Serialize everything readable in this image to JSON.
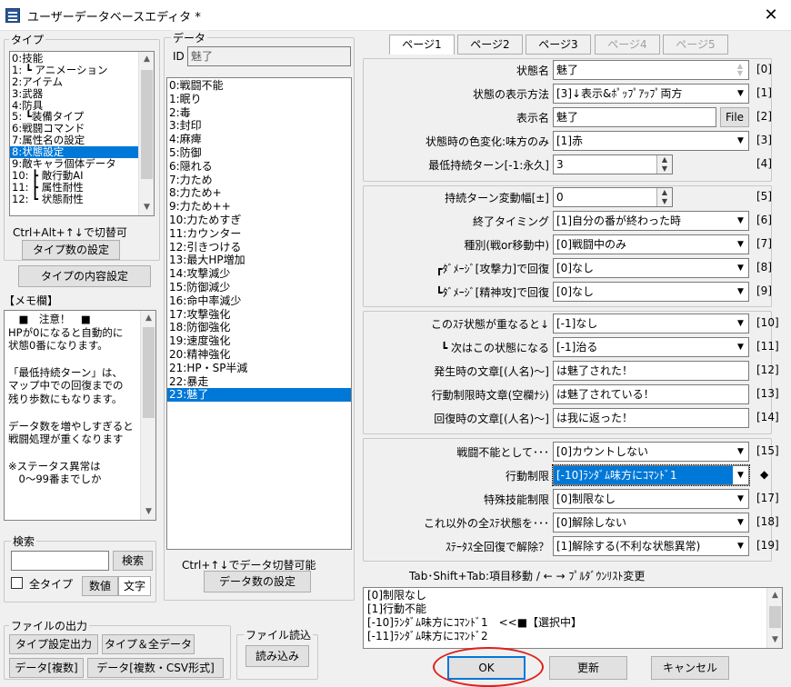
{
  "window": {
    "title": "ユーザーデータベースエディタ *",
    "close": "✕"
  },
  "type_panel": {
    "label": "タイプ",
    "items": [
      "0:技能",
      "1: ┗ アニメーション",
      "2:アイテム",
      "3:武器",
      "4:防具",
      "5: ┗装備タイプ",
      "6:戦闘コマンド",
      "7:属性名の設定",
      "8:状態設定",
      "9:敵キャラ個体データ",
      "10: ┣ 敵行動AI",
      "11: ┣ 属性耐性",
      "12: ┗ 状態耐性"
    ],
    "selected": 8,
    "hint": "Ctrl+Alt+↑↓で切替可",
    "count_button": "タイプ数の設定",
    "content_button": "タイプの内容設定"
  },
  "memo": {
    "label": "【メモ欄】",
    "lines": [
      "　■　注意！　■",
      "HPが0になると自動的に",
      "状態0番になります。",
      "",
      "「最低持続ターン」は、",
      "マップ中での回復までの",
      "残り歩数にもなります。",
      "",
      "データ数を増やしすぎると",
      "戦闘処理が重くなります",
      "",
      "※ステータス異常は",
      "　0〜99番までしか"
    ]
  },
  "search": {
    "label": "検索",
    "button": "検索",
    "all_types": "全タイプ",
    "value_btn": "数値",
    "text_btn": "文字"
  },
  "file_output": {
    "label": "ファイルの出力",
    "btn1": "タイプ設定出力",
    "btn2": "タイプ＆全データ",
    "btn3": "データ[複数]",
    "btn4": "データ[複数・CSV形式]"
  },
  "file_input": {
    "label": "ファイル読込",
    "btn": "読み込み"
  },
  "data_panel": {
    "label": "データ",
    "id_label": "ID",
    "id_value": "魅了",
    "items": [
      "0:戦闘不能",
      "1:眠り",
      "2:毒",
      "3:封印",
      "4:麻痺",
      "5:防御",
      "6:隠れる",
      "7:力ため",
      "8:力ため+",
      "9:力ため++",
      "10:力ためすぎ",
      "11:カウンター",
      "12:引きつける",
      "13:最大HP増加",
      "14:攻撃減少",
      "15:防御減少",
      "16:命中率減少",
      "17:攻撃強化",
      "18:防御強化",
      "19:速度強化",
      "20:精神強化",
      "21:HP・SP半減",
      "22:暴走",
      "23:魅了"
    ],
    "selected": 23,
    "hint": "Ctrl+↑↓でデータ切替可能",
    "count_button": "データ数の設定"
  },
  "tabs": [
    {
      "label": "ページ1",
      "state": "active"
    },
    {
      "label": "ページ2",
      "state": "normal"
    },
    {
      "label": "ページ3",
      "state": "normal"
    },
    {
      "label": "ページ4",
      "state": "disabled"
    },
    {
      "label": "ページ5",
      "state": "disabled"
    }
  ],
  "section1": [
    {
      "label": "状態名",
      "kind": "text",
      "value": "魅了",
      "index": "[0]"
    },
    {
      "label": "状態の表示方法",
      "kind": "dropdown",
      "value": "[3]↓表示&ﾎﾟｯﾌﾟｱｯﾌﾟ両方",
      "index": "[1]"
    },
    {
      "label": "表示名",
      "kind": "file",
      "value": "魅了",
      "button": "File",
      "index": "[2]"
    },
    {
      "label": "状態時の色変化:味方のみ",
      "kind": "dropdown",
      "value": "[1]赤",
      "index": "[3]"
    },
    {
      "label": "最低持続ターン[-1:永久]",
      "kind": "number",
      "value": "3",
      "index": "[4]"
    }
  ],
  "section2": [
    {
      "label": "持続ターン変動幅[±]",
      "kind": "number",
      "value": "0",
      "index": "[5]"
    },
    {
      "label": "終了タイミング",
      "kind": "dropdown",
      "value": "[1]自分の番が終わった時",
      "index": "[6]"
    },
    {
      "label": "種別(戦or移動中)",
      "kind": "dropdown",
      "value": "[0]戦闘中のみ",
      "index": "[7]"
    },
    {
      "label": "┏ﾀﾞﾒｰｼﾞ[攻撃力]で回復",
      "kind": "dropdown",
      "value": "[0]なし",
      "index": "[8]"
    },
    {
      "label": "┗ﾀﾞﾒｰｼﾞ[精神攻]で回復",
      "kind": "dropdown",
      "value": "[0]なし",
      "index": "[9]"
    }
  ],
  "section3": [
    {
      "label": "このｽﾃ状態が重なると↓",
      "kind": "dropdown",
      "value": "[-1]なし",
      "index": "[10]"
    },
    {
      "label": "┗ 次はこの状態になる",
      "kind": "dropdown",
      "value": "[-1]治る",
      "index": "[11]"
    },
    {
      "label": "発生時の文章[(人名)〜]",
      "kind": "text",
      "value": "は魅了された！",
      "index": "[12]"
    },
    {
      "label": "行動制限時文章(空欄ﾅｼ)",
      "kind": "text",
      "value": "は魅了されている！",
      "index": "[13]"
    },
    {
      "label": "回復時の文章[(人名)〜]",
      "kind": "text",
      "value": "は我に返った！",
      "index": "[14]"
    }
  ],
  "section4": [
    {
      "label": "戦闘不能として･･･",
      "kind": "dropdown",
      "value": "[0]カウントしない",
      "index": "[15]"
    },
    {
      "label": "行動制限",
      "kind": "dropdown",
      "value": "[-10]ﾗﾝﾀﾞﾑ味方にｺﾏﾝﾄﾞ1",
      "index": "◆",
      "highlight": true
    },
    {
      "label": "特殊技能制限",
      "kind": "dropdown",
      "value": "[0]制限なし",
      "index": "[17]"
    },
    {
      "label": "これ以外の全ｽﾃ状態を･･･",
      "kind": "dropdown",
      "value": "[0]解除しない",
      "index": "[18]"
    },
    {
      "label": "ｽﾃｰﾀｽ全回復で解除？",
      "kind": "dropdown",
      "value": "[1]解除する(不利な状態異常)",
      "index": "[19]"
    }
  ],
  "nav_hint": "Tab･Shift+Tab:項目移動 / ← → ﾌﾟﾙﾀﾞｳﾝﾘｽﾄ変更",
  "option_list": [
    "[0]制限なし",
    "[1]行動不能",
    "[-10]ﾗﾝﾀﾞﾑ味方にｺﾏﾝﾄﾞ1　<<■【選択中】",
    "[-11]ﾗﾝﾀﾞﾑ味方にｺﾏﾝﾄﾞ2"
  ],
  "footer": {
    "ok": "OK",
    "update": "更新",
    "cancel": "キャンセル"
  },
  "colors": {
    "selection": "#0078d7",
    "annotation": "#e0201c"
  }
}
